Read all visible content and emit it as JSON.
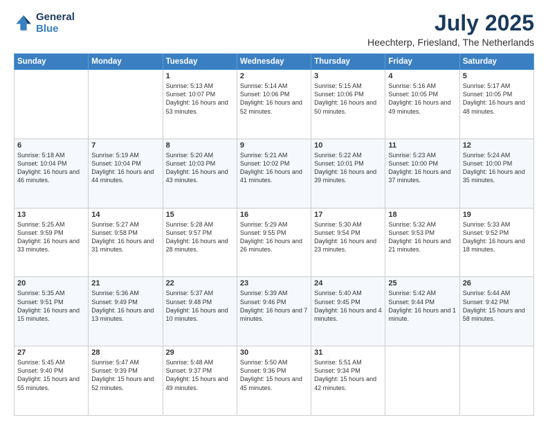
{
  "logo": {
    "line1": "General",
    "line2": "Blue"
  },
  "title": "July 2025",
  "location": "Heechterp, Friesland, The Netherlands",
  "days_of_week": [
    "Sunday",
    "Monday",
    "Tuesday",
    "Wednesday",
    "Thursday",
    "Friday",
    "Saturday"
  ],
  "weeks": [
    [
      {
        "day": "",
        "data": ""
      },
      {
        "day": "",
        "data": ""
      },
      {
        "day": "1",
        "data": "Sunrise: 5:13 AM\nSunset: 10:07 PM\nDaylight: 16 hours and 53 minutes."
      },
      {
        "day": "2",
        "data": "Sunrise: 5:14 AM\nSunset: 10:06 PM\nDaylight: 16 hours and 52 minutes."
      },
      {
        "day": "3",
        "data": "Sunrise: 5:15 AM\nSunset: 10:06 PM\nDaylight: 16 hours and 50 minutes."
      },
      {
        "day": "4",
        "data": "Sunrise: 5:16 AM\nSunset: 10:05 PM\nDaylight: 16 hours and 49 minutes."
      },
      {
        "day": "5",
        "data": "Sunrise: 5:17 AM\nSunset: 10:05 PM\nDaylight: 16 hours and 48 minutes."
      }
    ],
    [
      {
        "day": "6",
        "data": "Sunrise: 5:18 AM\nSunset: 10:04 PM\nDaylight: 16 hours and 46 minutes."
      },
      {
        "day": "7",
        "data": "Sunrise: 5:19 AM\nSunset: 10:04 PM\nDaylight: 16 hours and 44 minutes."
      },
      {
        "day": "8",
        "data": "Sunrise: 5:20 AM\nSunset: 10:03 PM\nDaylight: 16 hours and 43 minutes."
      },
      {
        "day": "9",
        "data": "Sunrise: 5:21 AM\nSunset: 10:02 PM\nDaylight: 16 hours and 41 minutes."
      },
      {
        "day": "10",
        "data": "Sunrise: 5:22 AM\nSunset: 10:01 PM\nDaylight: 16 hours and 39 minutes."
      },
      {
        "day": "11",
        "data": "Sunrise: 5:23 AM\nSunset: 10:00 PM\nDaylight: 16 hours and 37 minutes."
      },
      {
        "day": "12",
        "data": "Sunrise: 5:24 AM\nSunset: 10:00 PM\nDaylight: 16 hours and 35 minutes."
      }
    ],
    [
      {
        "day": "13",
        "data": "Sunrise: 5:25 AM\nSunset: 9:59 PM\nDaylight: 16 hours and 33 minutes."
      },
      {
        "day": "14",
        "data": "Sunrise: 5:27 AM\nSunset: 9:58 PM\nDaylight: 16 hours and 31 minutes."
      },
      {
        "day": "15",
        "data": "Sunrise: 5:28 AM\nSunset: 9:57 PM\nDaylight: 16 hours and 28 minutes."
      },
      {
        "day": "16",
        "data": "Sunrise: 5:29 AM\nSunset: 9:55 PM\nDaylight: 16 hours and 26 minutes."
      },
      {
        "day": "17",
        "data": "Sunrise: 5:30 AM\nSunset: 9:54 PM\nDaylight: 16 hours and 23 minutes."
      },
      {
        "day": "18",
        "data": "Sunrise: 5:32 AM\nSunset: 9:53 PM\nDaylight: 16 hours and 21 minutes."
      },
      {
        "day": "19",
        "data": "Sunrise: 5:33 AM\nSunset: 9:52 PM\nDaylight: 16 hours and 18 minutes."
      }
    ],
    [
      {
        "day": "20",
        "data": "Sunrise: 5:35 AM\nSunset: 9:51 PM\nDaylight: 16 hours and 15 minutes."
      },
      {
        "day": "21",
        "data": "Sunrise: 5:36 AM\nSunset: 9:49 PM\nDaylight: 16 hours and 13 minutes."
      },
      {
        "day": "22",
        "data": "Sunrise: 5:37 AM\nSunset: 9:48 PM\nDaylight: 16 hours and 10 minutes."
      },
      {
        "day": "23",
        "data": "Sunrise: 5:39 AM\nSunset: 9:46 PM\nDaylight: 16 hours and 7 minutes."
      },
      {
        "day": "24",
        "data": "Sunrise: 5:40 AM\nSunset: 9:45 PM\nDaylight: 16 hours and 4 minutes."
      },
      {
        "day": "25",
        "data": "Sunrise: 5:42 AM\nSunset: 9:44 PM\nDaylight: 16 hours and 1 minute."
      },
      {
        "day": "26",
        "data": "Sunrise: 5:44 AM\nSunset: 9:42 PM\nDaylight: 15 hours and 58 minutes."
      }
    ],
    [
      {
        "day": "27",
        "data": "Sunrise: 5:45 AM\nSunset: 9:40 PM\nDaylight: 15 hours and 55 minutes."
      },
      {
        "day": "28",
        "data": "Sunrise: 5:47 AM\nSunset: 9:39 PM\nDaylight: 15 hours and 52 minutes."
      },
      {
        "day": "29",
        "data": "Sunrise: 5:48 AM\nSunset: 9:37 PM\nDaylight: 15 hours and 49 minutes."
      },
      {
        "day": "30",
        "data": "Sunrise: 5:50 AM\nSunset: 9:36 PM\nDaylight: 15 hours and 45 minutes."
      },
      {
        "day": "31",
        "data": "Sunrise: 5:51 AM\nSunset: 9:34 PM\nDaylight: 15 hours and 42 minutes."
      },
      {
        "day": "",
        "data": ""
      },
      {
        "day": "",
        "data": ""
      }
    ]
  ]
}
